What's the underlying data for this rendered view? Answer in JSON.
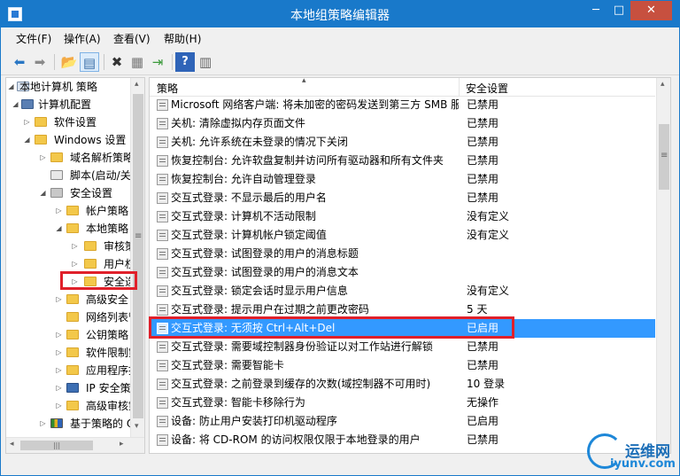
{
  "window": {
    "title": "本地组策略编辑器",
    "min_glyph": "─",
    "max_glyph": "□",
    "close_glyph": "✕"
  },
  "menu": [
    "文件(F)",
    "操作(A)",
    "查看(V)",
    "帮助(H)"
  ],
  "toolbar": {
    "icons": [
      "back-icon",
      "forward-icon",
      "up-folder-icon",
      "show-tree-icon",
      "delete-icon",
      "properties-icon",
      "export-icon",
      "help-icon",
      "extended-view-icon"
    ],
    "glyphs": [
      "⬅",
      "➡",
      "📂",
      "▤",
      "✖",
      "▦",
      "⇥",
      "?",
      "▥"
    ]
  },
  "tree": {
    "items": [
      {
        "label": "本地计算机 策略",
        "icon": "computer-policy-icon"
      },
      {
        "label": "计算机配置",
        "icon": "computer-icon"
      },
      {
        "label": "软件设置",
        "icon": "folder-icon"
      },
      {
        "label": "Windows 设置",
        "icon": "folder-icon"
      },
      {
        "label": "域名解析策略",
        "icon": "folder-icon"
      },
      {
        "label": "脚本(启动/关机)",
        "icon": "script-icon"
      },
      {
        "label": "安全设置",
        "icon": "shield-icon"
      },
      {
        "label": "帐户策略",
        "icon": "folder-icon"
      },
      {
        "label": "本地策略",
        "icon": "folder-icon"
      },
      {
        "label": "审核策略",
        "icon": "folder-icon"
      },
      {
        "label": "用户权限分配",
        "icon": "folder-icon"
      },
      {
        "label": "安全选项",
        "icon": "folder-icon"
      },
      {
        "label": "高级安全 Windows 防火墙",
        "icon": "folder-icon"
      },
      {
        "label": "网络列表管理器策略",
        "icon": "folder-icon"
      },
      {
        "label": "公钥策略",
        "icon": "folder-icon"
      },
      {
        "label": "软件限制策略",
        "icon": "folder-icon"
      },
      {
        "label": "应用程序控制策略",
        "icon": "folder-icon"
      },
      {
        "label": "IP 安全策略",
        "icon": "ip-security-icon"
      },
      {
        "label": "高级审核策略配置",
        "icon": "folder-icon"
      },
      {
        "label": "基于策略的 QoS",
        "icon": "chart-icon"
      }
    ]
  },
  "list": {
    "columns": [
      "策略",
      "安全设置"
    ],
    "rows": [
      {
        "name": "Microsoft 网络客户端: 将未加密的密码发送到第三方 SMB 服务器",
        "value": "已禁用"
      },
      {
        "name": "关机: 清除虚拟内存页面文件",
        "value": "已禁用"
      },
      {
        "name": "关机: 允许系统在未登录的情况下关闭",
        "value": "已禁用"
      },
      {
        "name": "恢复控制台: 允许软盘复制并访问所有驱动器和所有文件夹",
        "value": "已禁用"
      },
      {
        "name": "恢复控制台: 允许自动管理登录",
        "value": "已禁用"
      },
      {
        "name": "交互式登录: 不显示最后的用户名",
        "value": "已禁用"
      },
      {
        "name": "交互式登录: 计算机不活动限制",
        "value": "没有定义"
      },
      {
        "name": "交互式登录: 计算机帐户锁定阈值",
        "value": "没有定义"
      },
      {
        "name": "交互式登录: 试图登录的用户的消息标题",
        "value": ""
      },
      {
        "name": "交互式登录: 试图登录的用户的消息文本",
        "value": ""
      },
      {
        "name": "交互式登录: 锁定会话时显示用户信息",
        "value": "没有定义"
      },
      {
        "name": "交互式登录: 提示用户在过期之前更改密码",
        "value": "5 天"
      },
      {
        "name": "交互式登录: 无须按 Ctrl+Alt+Del",
        "value": "已启用"
      },
      {
        "name": "交互式登录: 需要域控制器身份验证以对工作站进行解锁",
        "value": "已禁用"
      },
      {
        "name": "交互式登录: 需要智能卡",
        "value": "已禁用"
      },
      {
        "name": "交互式登录: 之前登录到缓存的次数(域控制器不可用时)",
        "value": "10 登录"
      },
      {
        "name": "交互式登录: 智能卡移除行为",
        "value": "无操作"
      },
      {
        "name": "设备: 防止用户安装打印机驱动程序",
        "value": "已启用"
      },
      {
        "name": "设备: 将 CD-ROM 的访问权限仅限于本地登录的用户",
        "value": "已禁用"
      }
    ]
  },
  "scroll": {
    "up": "▴",
    "down": "▾",
    "left": "◂",
    "right": "▸",
    "grip": "≡",
    "hgrip": "|||"
  },
  "watermark": {
    "text": "运维网",
    "domain": "iyunv.com"
  }
}
